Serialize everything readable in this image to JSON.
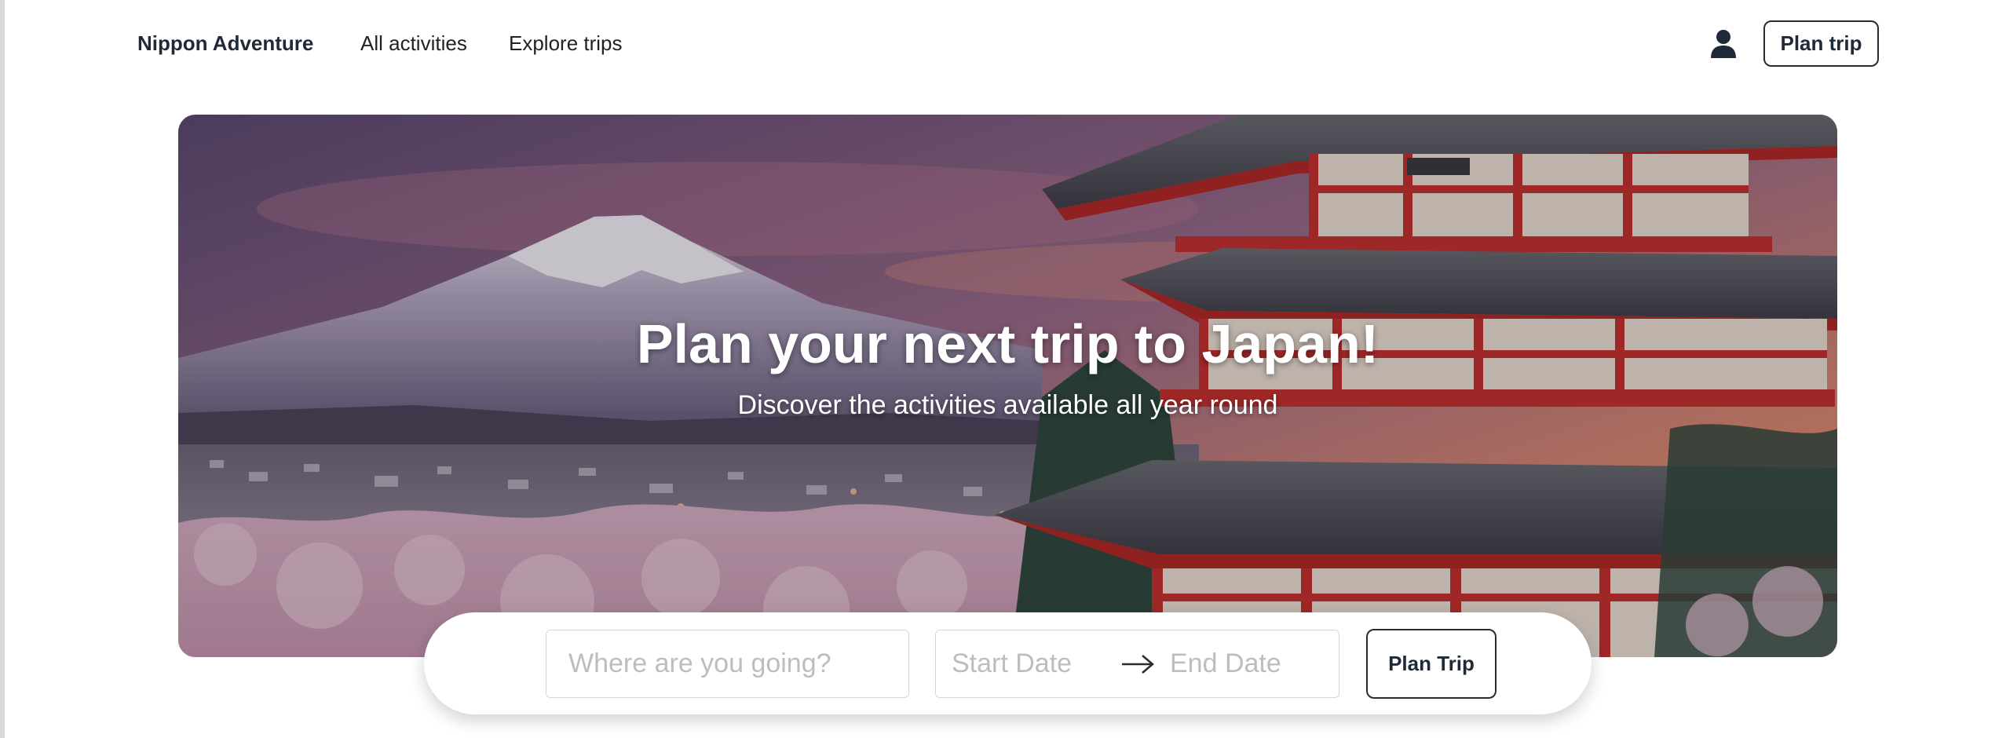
{
  "header": {
    "brand": "Nippon Adventure",
    "nav": [
      {
        "label": "All activities"
      },
      {
        "label": "Explore trips"
      }
    ],
    "user_icon": "user-icon",
    "plan_button": "Plan trip"
  },
  "hero": {
    "title": "Plan your next trip to Japan!",
    "subtitle": "Discover the activities available all year round"
  },
  "search": {
    "destination_placeholder": "Where are you going?",
    "start_date_placeholder": "Start Date",
    "end_date_placeholder": "End Date",
    "arrow_icon": "arrow-right-icon",
    "submit_label": "Plan Trip"
  }
}
